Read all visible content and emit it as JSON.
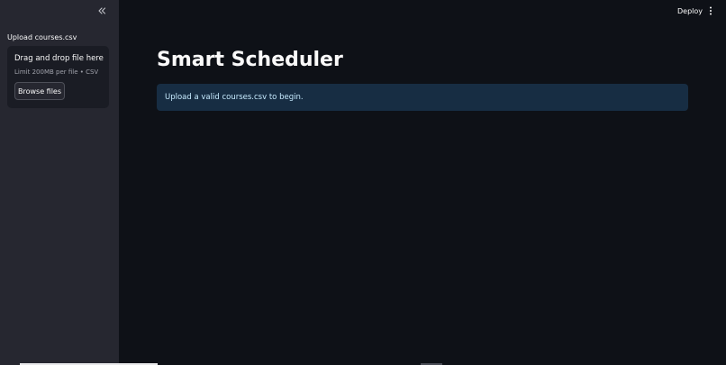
{
  "sidebar": {
    "collapse_icon": "double-chevron-left-icon",
    "upload_label": "Upload courses.csv",
    "dropzone": {
      "title": "Drag and drop file here",
      "limit": "Limit 200MB per file • CSV",
      "browse_label": "Browse files"
    }
  },
  "header": {
    "deploy_label": "Deploy",
    "menu_icon": "vertical-ellipsis-icon"
  },
  "main": {
    "title": "Smart Scheduler",
    "info_message": "Upload a valid courses.csv to begin."
  },
  "colors": {
    "background": "#0e1117",
    "sidebar": "#262730",
    "info_background": "#172d43",
    "info_text": "#c7ebff"
  }
}
